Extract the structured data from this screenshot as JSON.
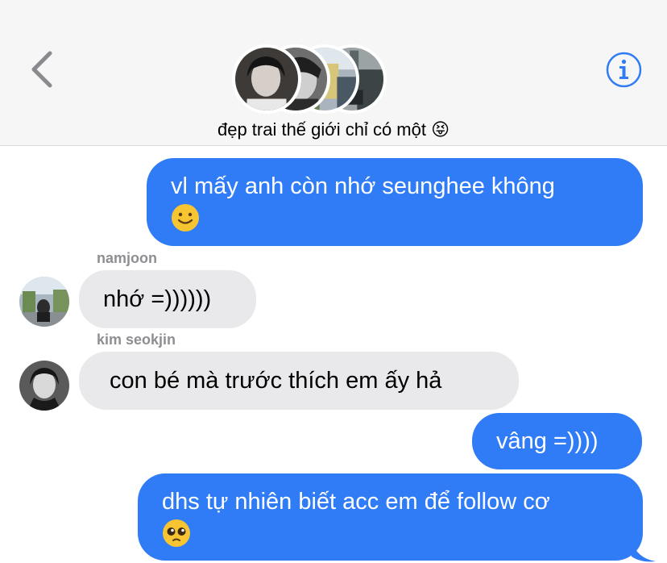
{
  "header": {
    "title": "đẹp trai thế giới chỉ có một",
    "title_emoji": "😝",
    "back_icon": "chevron-left-icon",
    "info_icon": "info-circle-icon",
    "group_avatars": [
      "member-photo-1",
      "member-photo-2",
      "member-photo-3",
      "member-photo-4"
    ]
  },
  "colors": {
    "outgoing_bubble": "#2f7cf6",
    "incoming_bubble": "#e9e9eb",
    "accent": "#2f7cf6",
    "sender_name": "#8e8e93"
  },
  "messages": [
    {
      "direction": "outgoing",
      "line1": "vl mấy anh còn nhớ seunghee không",
      "emoji": "🙂"
    },
    {
      "direction": "incoming",
      "sender": "namjoon",
      "text": "nhớ =))))))"
    },
    {
      "direction": "incoming",
      "sender": "kim seokjin",
      "text": "con bé mà trước thích em ấy hả"
    },
    {
      "direction": "outgoing",
      "text": "vâng =))))"
    },
    {
      "direction": "outgoing",
      "line1": "dhs tự nhiên biết acc em để follow cơ",
      "emoji": "🥺"
    }
  ]
}
